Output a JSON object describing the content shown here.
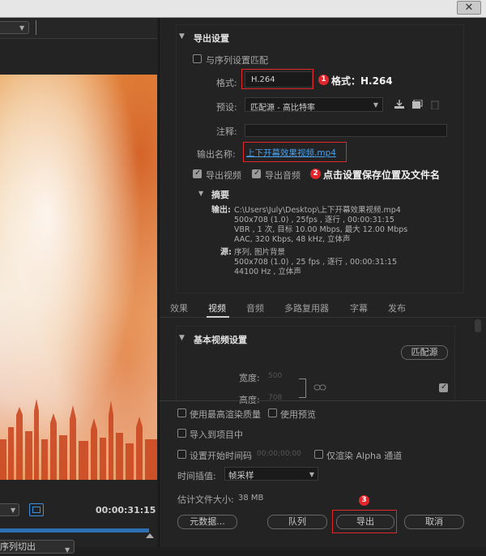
{
  "window": {
    "close_glyph": "✕"
  },
  "left_panel": {
    "timecode": "00:00:31:15",
    "bottom_dropdown_label": "序列切出"
  },
  "export_settings": {
    "section_title": "导出设置",
    "match_sequence_label": "与序列设置匹配",
    "format_label": "格式:",
    "format_value": "H.264",
    "preset_label": "预设:",
    "preset_value": "匹配源 - 高比特率",
    "comment_label": "注释:",
    "comment_value": "",
    "output_name_label": "输出名称:",
    "output_name_value": "上下开幕效果视频.mp4",
    "export_video_label": "导出视频",
    "export_audio_label": "导出音频"
  },
  "summary": {
    "title": "摘要",
    "output_label": "输出:",
    "output_lines": [
      "C:\\Users\\July\\Desktop\\上下开幕效果视频.mp4",
      "500x708 (1.0) , 25fps , 逐行 , 00:00:31:15",
      "VBR , 1 次, 目标 10.00 Mbps, 最大 12.00 Mbps",
      "AAC, 320 Kbps, 48 kHz, 立体声"
    ],
    "source_label": "源:",
    "source_lines": [
      "序列, 图片背景",
      "500x708 (1.0) , 25 fps , 逐行 , 00:00:31:15",
      "44100 Hz , 立体声"
    ]
  },
  "tabs": [
    "效果",
    "视频",
    "音频",
    "多路复用器",
    "字幕",
    "发布"
  ],
  "active_tab_index": 1,
  "basic_video": {
    "title": "基本视频设置",
    "match_source_button": "匹配源",
    "width_label": "宽度:",
    "width_value": "500",
    "height_label": "高度:",
    "height_value": "708"
  },
  "bottom_options": {
    "max_render_quality": "使用最高渲染质量",
    "use_previews": "使用预览",
    "import_into_project": "导入到项目中",
    "set_start_timecode": "设置开始时间码",
    "start_timecode_value": "00;00;00;00",
    "render_alpha_only": "仅渲染 Alpha 通道",
    "time_interpolation_label": "时间插值:",
    "time_interpolation_value": "帧采样",
    "estimated_size_label": "估计文件大小:",
    "estimated_size_value": "38 MB"
  },
  "buttons": {
    "metadata": "元数据...",
    "queue": "队列",
    "export": "导出",
    "cancel": "取消"
  },
  "annotations": {
    "one_num": "1",
    "one_text": "格式：H.264",
    "two_num": "2",
    "two_text": "点击设置保存位置及文件名",
    "three_num": "3"
  },
  "colors": {
    "annotation_red": "#e3262b",
    "link_blue": "#4a9fe8",
    "timeline_blue": "#2d6fb3"
  },
  "icons": [
    "close-icon",
    "chevron-down-icon",
    "fit-frame-icon",
    "import-preset-icon",
    "save-preset-icon",
    "delete-preset-icon",
    "link-icon",
    "checkbox-icon"
  ]
}
